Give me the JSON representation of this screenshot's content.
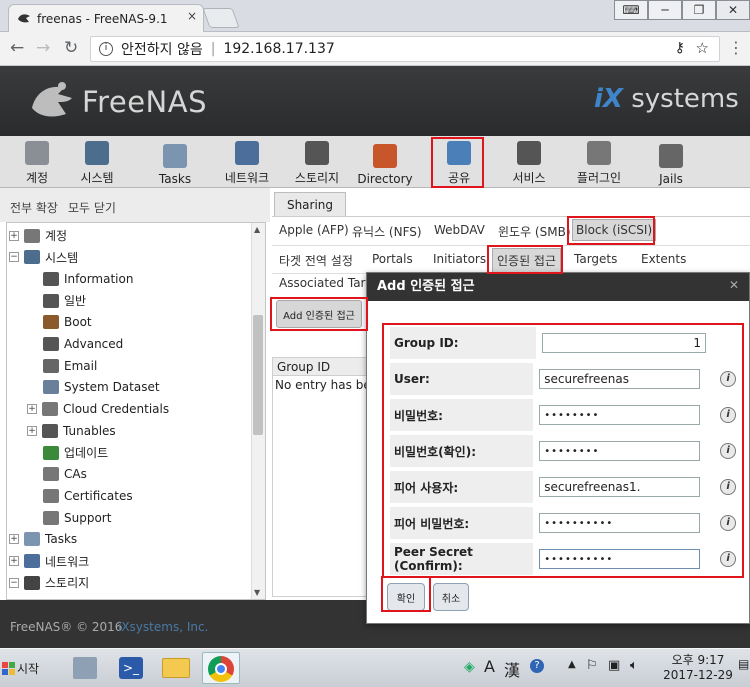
{
  "browser": {
    "tab_title": "freenas - FreeNAS-9.1",
    "tab_close": "×",
    "window_controls": [
      "⌨",
      "─",
      "❐",
      "✕"
    ],
    "security_label": "안전하지 않음",
    "url": "192.168.17.137"
  },
  "header": {
    "product_name": "FreeNAS",
    "vendor_ix": "iX",
    "vendor_rest": "systems"
  },
  "topnav": [
    {
      "label": "계정",
      "icon": "users-icon"
    },
    {
      "label": "시스템",
      "icon": "system-icon"
    },
    {
      "label": "Tasks",
      "icon": "clock-icon"
    },
    {
      "label": "네트워크",
      "icon": "network-icon"
    },
    {
      "label": "스토리지",
      "icon": "folder-icon"
    },
    {
      "label": "Directory",
      "icon": "directory-icon"
    },
    {
      "label": "공유",
      "icon": "sharing-icon"
    },
    {
      "label": "서비스",
      "icon": "services-icon"
    },
    {
      "label": "플러그인",
      "icon": "plugin-icon"
    },
    {
      "label": "Jails",
      "icon": "jails-icon"
    }
  ],
  "tree_toolbar": {
    "expand_all": "전부 확장",
    "collapse_all": "모두 닫기"
  },
  "tree": [
    {
      "label": "계정",
      "expander": "+",
      "level": 0
    },
    {
      "label": "시스템",
      "expander": "−",
      "level": 0
    },
    {
      "label": "Information",
      "level": 1
    },
    {
      "label": "일반",
      "level": 1
    },
    {
      "label": "Boot",
      "level": 1
    },
    {
      "label": "Advanced",
      "level": 1
    },
    {
      "label": "Email",
      "level": 1
    },
    {
      "label": "System Dataset",
      "level": 1
    },
    {
      "label": "Cloud Credentials",
      "expander": "+",
      "level": 1
    },
    {
      "label": "Tunables",
      "expander": "+",
      "level": 1
    },
    {
      "label": "업데이트",
      "level": 1
    },
    {
      "label": "CAs",
      "level": 1
    },
    {
      "label": "Certificates",
      "level": 1
    },
    {
      "label": "Support",
      "level": 1
    },
    {
      "label": "Tasks",
      "expander": "+",
      "level": 0
    },
    {
      "label": "네트워크",
      "expander": "+",
      "level": 0
    },
    {
      "label": "스토리지",
      "expander": "−",
      "level": 0
    }
  ],
  "main": {
    "sharing_tab": "Sharing",
    "share_tabs": [
      "Apple (AFP)",
      "유닉스 (NFS)",
      "WebDAV",
      "윈도우 (SMB)",
      "Block (iSCSI)"
    ],
    "iscsi_tabs": [
      "타겟 전역 설정",
      "Portals",
      "Initiators",
      "인증된 접근",
      "Targets",
      "Extents"
    ],
    "associated": "Associated Targ",
    "add_button": "Add 인증된 접근",
    "grid_header": "Group ID",
    "grid_empty": "No entry has bee"
  },
  "footer": {
    "copyright": "FreeNAS® © 2016",
    "vendor": "iXsystems, Inc."
  },
  "dialog": {
    "title": "Add 인증된 접근",
    "close": "✕",
    "fields": [
      {
        "label": "Group ID:",
        "value": "1"
      },
      {
        "label": "User:",
        "value": "securefreenas"
      },
      {
        "label": "비밀번호:",
        "value": "••••••••"
      },
      {
        "label": "비밀번호(확인):",
        "value": "••••••••"
      },
      {
        "label": "피어 사용자:",
        "value": "securefreenas1."
      },
      {
        "label": "피어 비밀번호:",
        "value": "••••••••••"
      },
      {
        "label": "Peer Secret (Confirm):",
        "value": "••••••••••"
      }
    ],
    "ok_button": "확인",
    "cancel_button": "취소"
  },
  "taskbar": {
    "start": "시작",
    "clock_line1": "오후 9:17",
    "clock_line2": "2017-12-29",
    "tray_a": "A",
    "tray_han": "漢"
  },
  "colors": {
    "highlight": "#e0141b",
    "header_bg": "#2f3032",
    "accent_blue": "#3e86c9"
  }
}
